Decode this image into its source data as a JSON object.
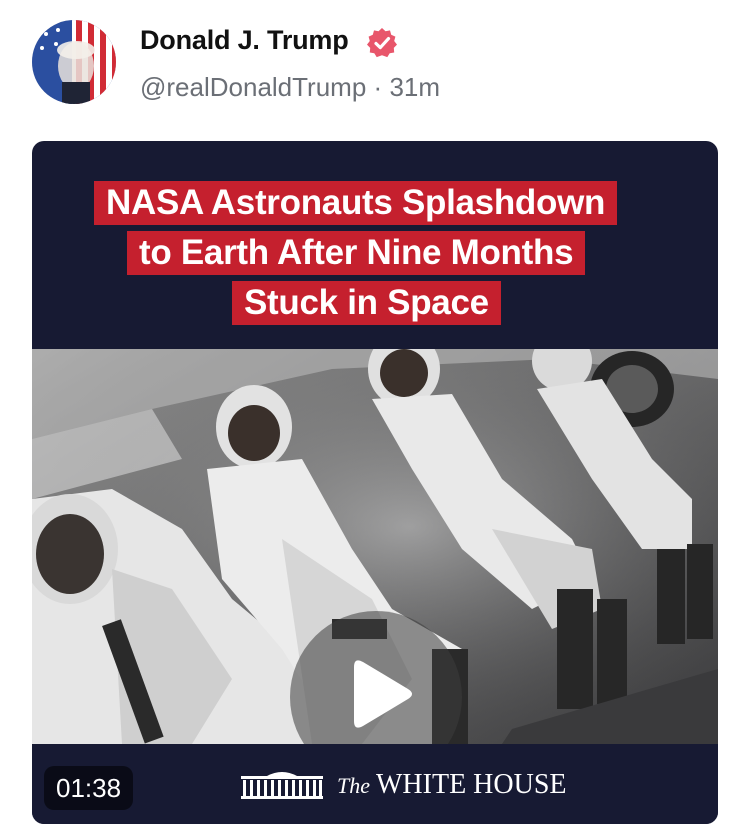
{
  "post": {
    "author_name": "Donald J. Trump",
    "handle": "@realDonaldTrump",
    "separator": "·",
    "time": "31m",
    "avatar_icon": "profile-portrait-flag",
    "verified_color": "#e8566b"
  },
  "media": {
    "headline_lines": [
      "NASA Astronauts Splashdown",
      "to Earth After Nine Months",
      "Stuck in Space"
    ],
    "headline_bg": "#c5202e",
    "background_color": "#171a33",
    "duration": "01:38",
    "brand_prefix": "The",
    "brand_name": "WHITE HOUSE",
    "play_icon": "play-icon"
  }
}
